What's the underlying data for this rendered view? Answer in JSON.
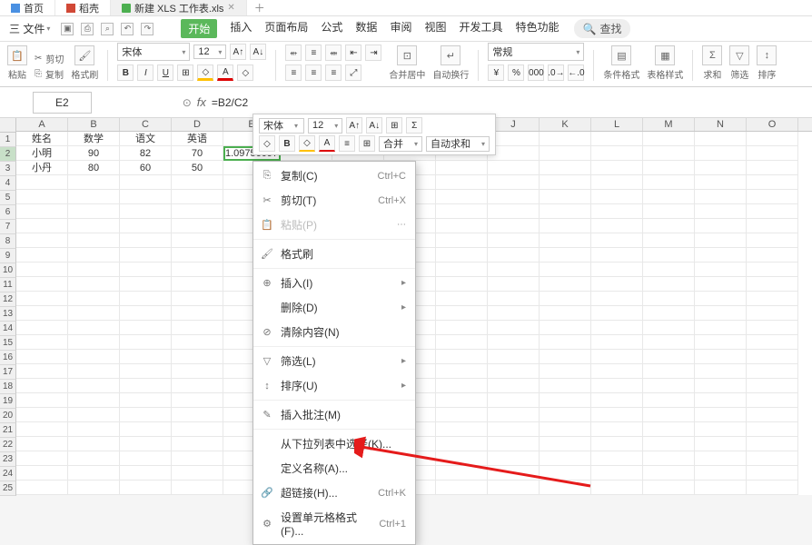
{
  "tabs": {
    "home": "首页",
    "doc": "稻壳",
    "sheet": "新建 XLS 工作表.xls"
  },
  "menu": {
    "file": "三 文件",
    "tabs": [
      "开始",
      "插入",
      "页面布局",
      "公式",
      "数据",
      "审阅",
      "视图",
      "开发工具",
      "特色功能"
    ],
    "search": "查找"
  },
  "toolbar": {
    "paste": "粘贴",
    "cut": "剪切",
    "copy": "复制",
    "format_painter": "格式刷",
    "font_name": "宋体",
    "font_size": "12",
    "merge_center": "合并居中",
    "wrap": "自动换行",
    "general": "常规",
    "cond_format": "条件格式",
    "table_style": "表格样式",
    "sum": "求和",
    "filter": "筛选",
    "sort": "排序"
  },
  "fbar": {
    "ref": "E2",
    "formula": "=B2/C2"
  },
  "mini": {
    "font": "宋体",
    "size": "12",
    "merge": "合并",
    "autosum": "自动求和"
  },
  "cols": [
    "A",
    "B",
    "C",
    "D",
    "E",
    "F",
    "G",
    "H",
    "I",
    "J",
    "K",
    "L",
    "M",
    "N",
    "O"
  ],
  "rows": [
    "1",
    "2",
    "3",
    "4",
    "5",
    "6",
    "7",
    "8",
    "9",
    "10",
    "11",
    "12",
    "13",
    "14",
    "15",
    "16",
    "17",
    "18",
    "19",
    "20",
    "21",
    "22",
    "23",
    "24",
    "25"
  ],
  "data": {
    "r1": {
      "A": "姓名",
      "B": "数学",
      "C": "语文",
      "D": "英语"
    },
    "r2": {
      "A": "小明",
      "B": "90",
      "C": "82",
      "D": "70",
      "E": "1.097560976"
    },
    "r3": {
      "A": "小丹",
      "B": "80",
      "C": "60",
      "D": "50"
    }
  },
  "cm": {
    "copy": "复制(C)",
    "cut": "剪切(T)",
    "paste": "粘贴(P)",
    "format_brush": "格式刷",
    "insert": "插入(I)",
    "delete": "删除(D)",
    "clear": "清除内容(N)",
    "filter": "筛选(L)",
    "sort": "排序(U)",
    "comment": "插入批注(M)",
    "dropdown_select": "从下拉列表中选择(K)...",
    "define_name": "定义名称(A)...",
    "hyperlink": "超链接(H)...",
    "cell_format": "设置单元格格式(F)...",
    "sc_copy": "Ctrl+C",
    "sc_cut": "Ctrl+X",
    "sc_link": "Ctrl+K",
    "sc_format": "Ctrl+1"
  }
}
